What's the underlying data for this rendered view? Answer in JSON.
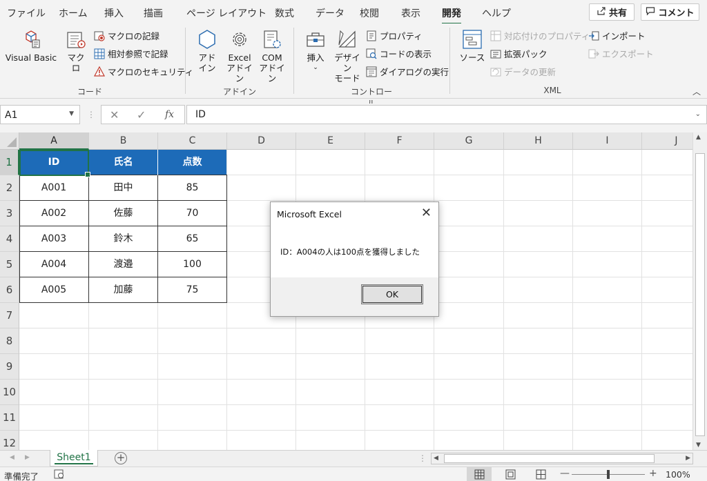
{
  "tabs": [
    "ファイル",
    "ホーム",
    "挿入",
    "描画",
    "ページ レイアウト",
    "数式",
    "データ",
    "校閲",
    "表示",
    "開発",
    "ヘルプ"
  ],
  "active_tab": "開発",
  "share_label": "共有",
  "comment_label": "コメント",
  "ribbon": {
    "code": {
      "visual_basic": "Visual Basic",
      "macro": "マクロ",
      "record_macro": "マクロの記録",
      "relative_ref": "相対参照で記録",
      "macro_security": "マクロのセキュリティ",
      "label": "コード"
    },
    "addins": {
      "addin_l1": "アド",
      "addin_l2": "イン",
      "excel_addin_l1": "Excel",
      "excel_addin_l2": "アドイン",
      "com_addin_l1": "COM",
      "com_addin_l2": "アドイン",
      "label": "アドイン"
    },
    "controls": {
      "insert": "挿入",
      "design_l1": "デザイン",
      "design_l2": "モード",
      "properties": "プロパティ",
      "view_code": "コードの表示",
      "run_dialog": "ダイアログの実行",
      "label": "コントロール"
    },
    "xml": {
      "source": "ソース",
      "map_props": "対応付けのプロパティ",
      "expansion": "拡張パック",
      "refresh": "データの更新",
      "import": "インポート",
      "export": "エクスポート",
      "label": "XML"
    }
  },
  "formula_bar": {
    "name_box": "A1",
    "value": "ID"
  },
  "columns": [
    "A",
    "B",
    "C",
    "D",
    "E",
    "F",
    "G",
    "H",
    "I",
    "J"
  ],
  "rows": [
    "1",
    "2",
    "3",
    "4",
    "5",
    "6",
    "7",
    "8",
    "9",
    "10",
    "11",
    "12"
  ],
  "table": {
    "headers": [
      "ID",
      "氏名",
      "点数"
    ],
    "rows": [
      [
        "A001",
        "田中",
        "85"
      ],
      [
        "A002",
        "佐藤",
        "70"
      ],
      [
        "A003",
        "鈴木",
        "65"
      ],
      [
        "A004",
        "渡邉",
        "100"
      ],
      [
        "A005",
        "加藤",
        "75"
      ]
    ]
  },
  "sheet_tab": "Sheet1",
  "status": {
    "ready": "準備完了",
    "zoom": "100%"
  },
  "dialog": {
    "title": "Microsoft Excel",
    "message": "ID：A004の人は100点を獲得しました",
    "ok": "OK"
  },
  "colors": {
    "accent": "#217346",
    "table_header": "#1d6bb8"
  }
}
